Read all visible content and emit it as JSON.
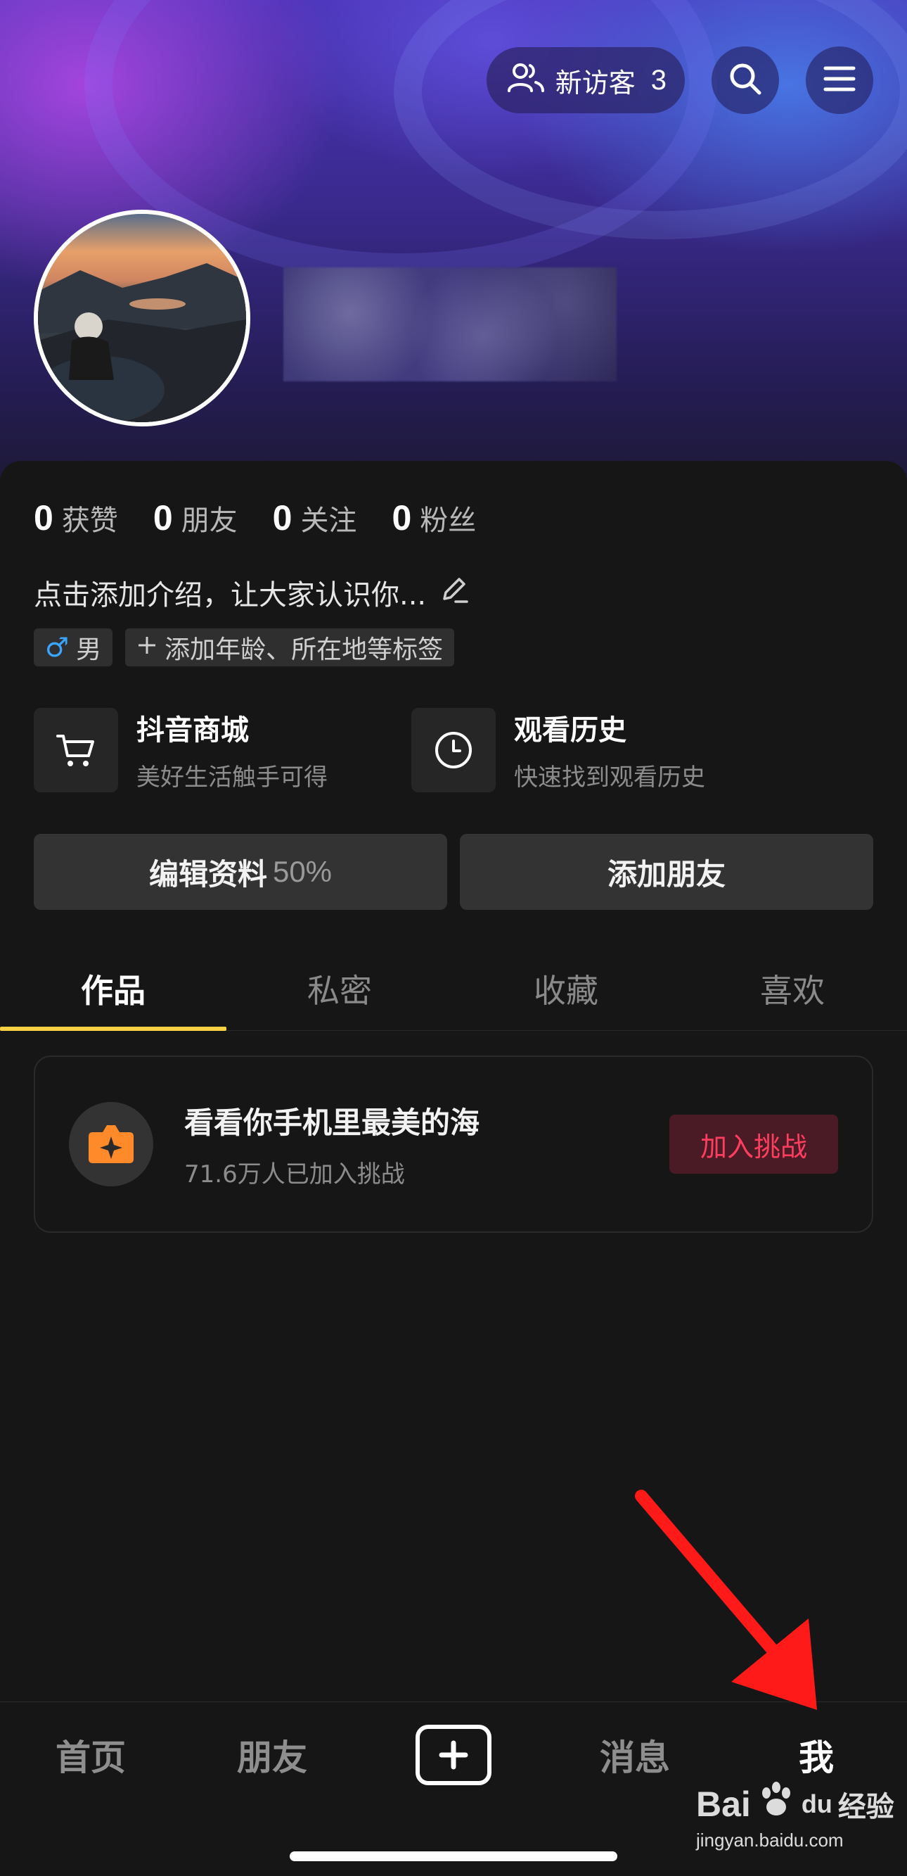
{
  "header": {
    "visitor_label": "新访客",
    "visitor_count": "3",
    "icons": [
      "visitors-icon",
      "search-icon",
      "menu-icon"
    ]
  },
  "stats": [
    {
      "num": "0",
      "label": "获赞"
    },
    {
      "num": "0",
      "label": "朋友"
    },
    {
      "num": "0",
      "label": "关注"
    },
    {
      "num": "0",
      "label": "粉丝"
    }
  ],
  "intro": "点击添加介绍，让大家认识你...",
  "tags": {
    "gender_symbol": "♂",
    "gender": "男",
    "add_tags": "添加年龄、所在地等标签"
  },
  "shortcuts": [
    {
      "title": "抖音商城",
      "subtitle": "美好生活触手可得",
      "icon": "cart-icon"
    },
    {
      "title": "观看历史",
      "subtitle": "快速找到观看历史",
      "icon": "clock-icon"
    }
  ],
  "actions": {
    "edit_label": "编辑资料",
    "edit_percent": "50%",
    "add_friend": "添加朋友"
  },
  "tabs": [
    "作品",
    "私密",
    "收藏",
    "喜欢"
  ],
  "challenge": {
    "title": "看看你手机里最美的海",
    "subtitle": "71.6万人已加入挑战",
    "button": "加入挑战"
  },
  "nav": [
    "首页",
    "朋友",
    "消息",
    "我"
  ],
  "watermark": {
    "brand_a": "Bai",
    "brand_b": "du",
    "brand_c": "经验",
    "url": "jingyan.baidu.com"
  },
  "colors": {
    "accent_tab": "#f6d143",
    "join_text": "#ff3d5f",
    "arrow": "#ff1a1a"
  }
}
